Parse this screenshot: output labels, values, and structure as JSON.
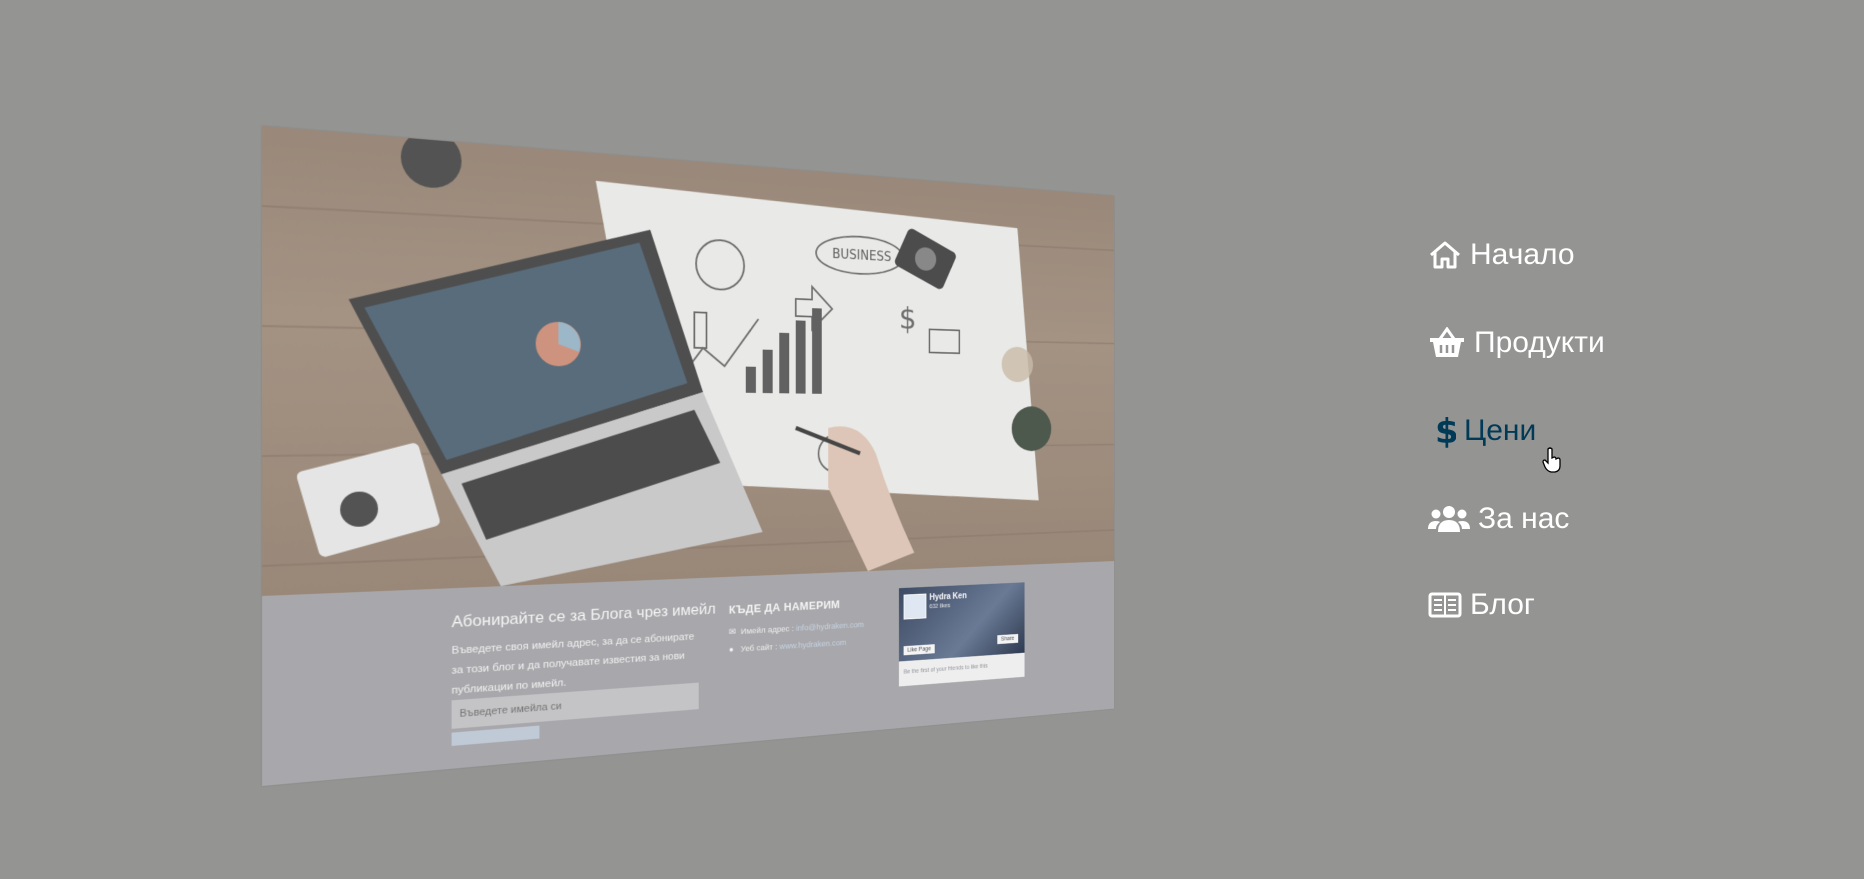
{
  "nav": {
    "items": [
      {
        "label": "Начало",
        "icon": "home-icon"
      },
      {
        "label": "Продукти",
        "icon": "basket-icon"
      },
      {
        "label": "Цени",
        "icon": "dollar-icon",
        "active": true
      },
      {
        "label": "За нас",
        "icon": "users-icon"
      },
      {
        "label": "Блог",
        "icon": "newspaper-icon"
      }
    ],
    "active_color": "#003a57",
    "text_color": "#ffffff"
  },
  "preview": {
    "hero_illustration": "BUSINESS",
    "subscribe": {
      "title": "Абонирайте се за Блога чрез имейл",
      "text": "Въведете своя имейл адрес, за да се абонирате за този блог и да получавате известия за нови публикации по имейл.",
      "placeholder": "Въведете имейла си"
    },
    "find_us": {
      "title": "КЪДЕ ДА НАМЕРИМ",
      "email_label": "Имейл адрес :",
      "email_value": "info@hydraken.com",
      "site_label": "Уеб сайт :",
      "site_value": "www.hydraken.com"
    },
    "facebook": {
      "page_name": "Hydra Ken",
      "likes": "632 likes",
      "like_button": "Like Page",
      "share_button": "Share",
      "footer_text": "Be the first of your friends to like this"
    }
  },
  "background_color": "#949492"
}
